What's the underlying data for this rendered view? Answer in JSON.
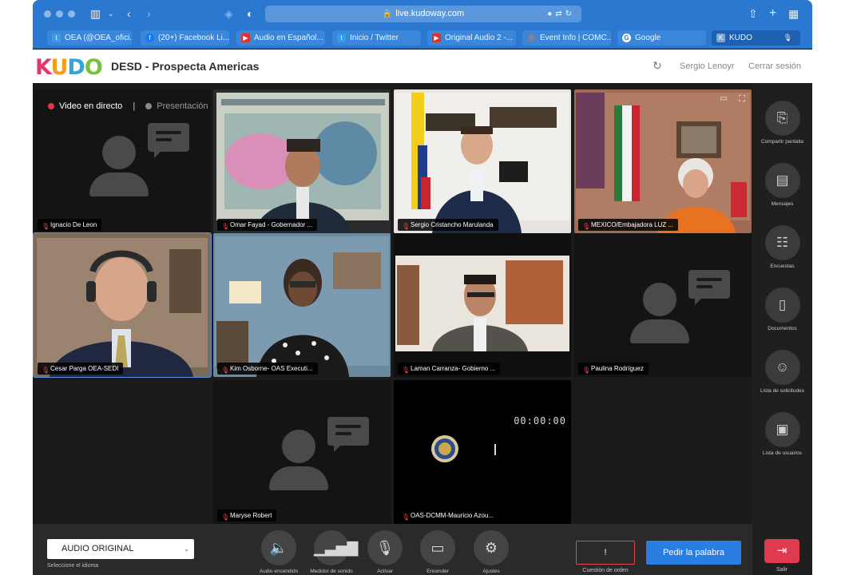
{
  "browser": {
    "url": "live.kudoway.com",
    "tabs": [
      {
        "label": "OEA (@OEA_ofici...",
        "icon": "twitter-icon"
      },
      {
        "label": "(20+) Facebook Li...",
        "icon": "facebook-icon"
      },
      {
        "label": "Audio en Español...",
        "icon": "youtube-icon"
      },
      {
        "label": "Inicio / Twitter",
        "icon": "twitter-icon"
      },
      {
        "label": "Original Audio 2 -...",
        "icon": "youtube-icon"
      },
      {
        "label": "Event Info | COMC...",
        "icon": "event-icon"
      },
      {
        "label": "Google",
        "icon": "google-icon"
      },
      {
        "label": "KUDO",
        "icon": "kudo-icon"
      }
    ]
  },
  "header": {
    "logo": [
      "K",
      "U",
      "D",
      "O"
    ],
    "title": "DESD - Prospecta Americas",
    "user": "Sergio Lenoyr",
    "logout": "Cerrar sesión"
  },
  "stage": {
    "live_label": "Video en directo",
    "divider": "|",
    "presentation_label": "Presentación",
    "timer": "00:00:00"
  },
  "participants": [
    {
      "name": "Ignacio De Leon",
      "video": false
    },
    {
      "name": "Omar Fayad - Gobernador ...",
      "video": true
    },
    {
      "name": "Sergio Cristancho Marulanda",
      "video": true
    },
    {
      "name": "MEXICO/Embajadora LUZ ...",
      "video": true
    },
    {
      "name": "Cesar Parga OEA-SEDI",
      "video": true,
      "selected": true
    },
    {
      "name": "Kim Osborne- OAS Executi...",
      "video": true
    },
    {
      "name": "Laman Carranza- Gobierno ...",
      "video": true
    },
    {
      "name": "Paulina Rodríguez",
      "video": false
    },
    {
      "name": "Maryse Robert",
      "video": false
    },
    {
      "name": "OAS-DCMM-Mauricio Azou...",
      "video": true
    }
  ],
  "side_panel": [
    {
      "label": "Compartir pantalla",
      "icon": "share-screen-icon"
    },
    {
      "label": "Mensajes",
      "icon": "messages-icon"
    },
    {
      "label": "Encuestas",
      "icon": "polls-icon"
    },
    {
      "label": "Documentos",
      "icon": "documents-icon"
    },
    {
      "label": "Lista de solicitudes",
      "icon": "requests-icon"
    },
    {
      "label": "Lista de usuarios",
      "icon": "users-icon"
    }
  ],
  "bottom": {
    "language_value": "AUDIO ORIGINAL",
    "language_caption": "Seleccione el idioma",
    "controls": [
      {
        "label": "Audio encendido",
        "icon": "speaker-icon"
      },
      {
        "label": "Medidor de sonido",
        "icon": "sound-meter-icon"
      },
      {
        "label": "Activar",
        "icon": "microphone-icon"
      },
      {
        "label": "Encender",
        "icon": "camera-icon"
      },
      {
        "label": "Ajustes",
        "icon": "settings-icon"
      }
    ],
    "order_value": "!",
    "order_label": "Cuestión de orden",
    "speak_label": "Pedir la palabra",
    "exit_label": "Salir"
  },
  "colors": {
    "browser_chrome": "#2b78d0",
    "accent_blue": "#2a7de1",
    "alert_red": "#e24b4b",
    "live_dot": "#e8354a"
  }
}
